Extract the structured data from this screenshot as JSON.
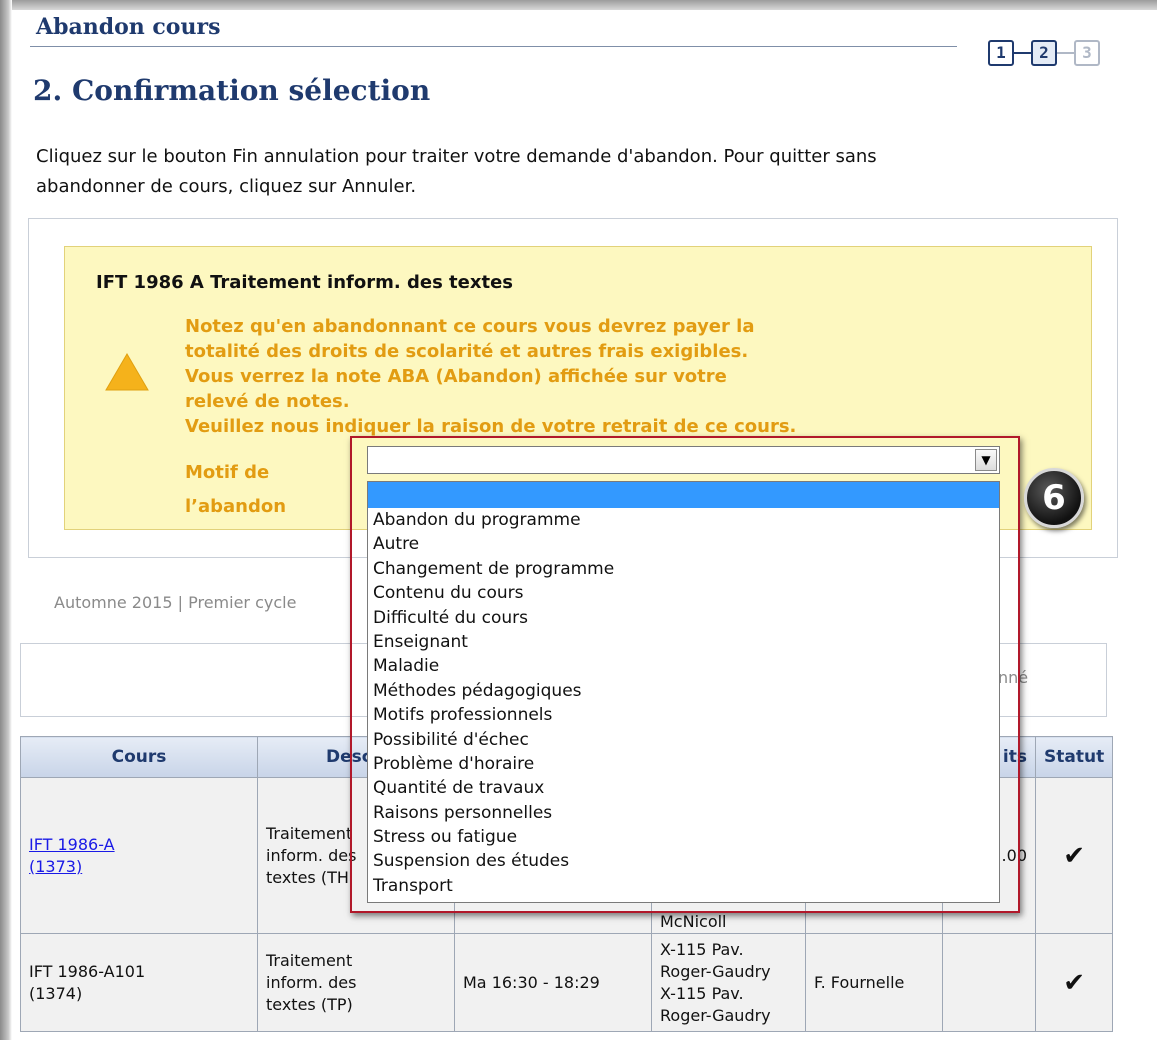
{
  "page": {
    "heading": "Abandon cours",
    "section_title": "2. Confirmation sélection",
    "instructions": "Cliquez sur le bouton Fin annulation pour traiter votre demande d'abandon. Pour quitter sans abandonner de cours, cliquez sur Annuler.",
    "steps": [
      "1",
      "2",
      "3"
    ],
    "current_step": 2
  },
  "warning": {
    "course_title": "IFT 1986 A Traitement inform. des textes",
    "icon": "warning-triangle-icon",
    "lines": [
      "Notez qu'en abandonnant ce cours vous devrez payer la",
      "totalité des droits de scolarité et autres frais exigibles.",
      "Vous verrez la note ABA (Abandon) affichée sur votre",
      "relevé de notes.",
      "Veuillez nous indiquer la raison de votre retrait de ce cours."
    ],
    "motif_label_line1": "Motif de",
    "motif_label_line2": "l’abandon",
    "select_value": "",
    "options": [
      "Abandon du programme",
      "Autre",
      "Changement de programme",
      "Contenu du cours",
      "Difficulté du cours",
      "Enseignant",
      "Maladie",
      "Méthodes pédagogiques",
      "Motifs professionnels",
      "Possibilité d'échec",
      "Problème d'horaire",
      "Quantité de travaux",
      "Raisons personnelles",
      "Stress ou fatigue",
      "Suspension des études",
      "Transport"
    ],
    "callout_number": "6"
  },
  "term": {
    "season": "Automne 2015",
    "separator": "|",
    "cycle": "Premier cycle"
  },
  "filter": {
    "partial_text": "donné"
  },
  "table": {
    "headers": [
      "Cours",
      "Descri",
      "its",
      "Statut"
    ],
    "rows": [
      {
        "course": "IFT 1986-A",
        "course_id": "(1373)",
        "description": [
          "Traitement",
          "inform. des",
          "textes (TH"
        ],
        "instructor_partial": "McNicoll",
        "credits": ".00",
        "status_icon": "check-icon"
      },
      {
        "course": "IFT 1986-A101",
        "course_id": "(1374)",
        "description": [
          "Traitement",
          "inform. des",
          "textes (TP)"
        ],
        "schedule": "Ma 16:30 - 18:29",
        "room": [
          "X-115 Pav.",
          "Roger-Gaudry",
          "X-115 Pav.",
          "Roger-Gaudry"
        ],
        "instructor": "F. Fournelle",
        "status_icon": "check-icon"
      }
    ]
  },
  "colors": {
    "heading_blue": "#1f3a6e",
    "warning_bg": "#fdf8c0",
    "warning_text": "#e29c12",
    "highlight_red": "#b1182a",
    "selected_blue": "#3399ff",
    "status_green": "#4cae3a"
  }
}
